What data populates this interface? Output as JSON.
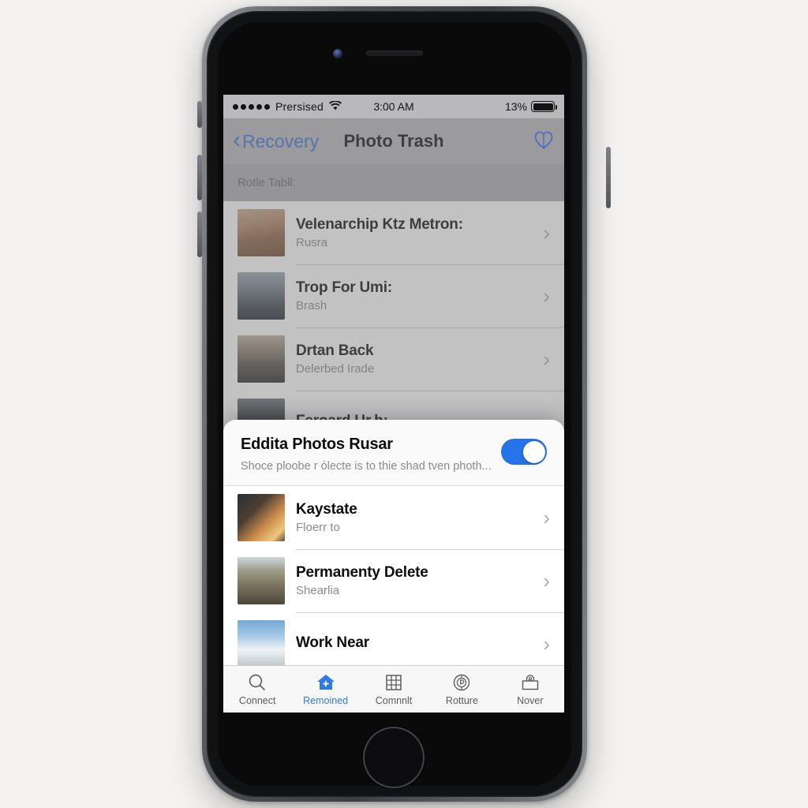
{
  "statusbar": {
    "carrier": "Prersised",
    "signal_dots": 5,
    "wifi_icon": "wifi-icon",
    "time": "3:00 AM",
    "battery_percent": "13%",
    "battery_level": 100
  },
  "navbar": {
    "back_label": "Recovery",
    "back_icon": "chevron-left-icon",
    "title": "Photo Trash",
    "action_icon": "heart-icon",
    "action_color": "#4a6fc4"
  },
  "section_header": {
    "label": "Rotle Tabll:"
  },
  "list": {
    "items": [
      {
        "title": "Velenarchip Ktz Metron:",
        "subtitle": "Rusra",
        "thumb": "stone-tower-photo",
        "chevron": "chevron-right-icon"
      },
      {
        "title": "Trop For Umi:",
        "subtitle": "Brash",
        "thumb": "tower-bridge-photo",
        "chevron": "chevron-right-icon"
      },
      {
        "title": "Drtan Back",
        "subtitle": "Delerbed Irade",
        "thumb": "person-road-photo",
        "chevron": "chevron-right-icon"
      },
      {
        "title": "Feroard Ur.b:",
        "subtitle": "",
        "thumb": "dark-object-photo",
        "chevron": "chevron-right-icon"
      }
    ]
  },
  "sheet": {
    "title": "Eddita Photos Rusar",
    "subtitle": "Shoce ploobe r όlecte is to thie shad tven photh...",
    "toggle_name": "edit-photos-toggle",
    "toggle_on": true,
    "toggle_color": "#2673e8",
    "items": [
      {
        "title": "Kaystate",
        "subtitle": "Floerr to",
        "thumb": "sunset-person-photo",
        "chevron": "chevron-right-icon"
      },
      {
        "title": "Permanenty Delete",
        "subtitle": "Shearlia",
        "thumb": "family-hill-photo",
        "chevron": "chevron-right-icon"
      },
      {
        "title": "Work Near",
        "subtitle": "",
        "thumb": "snow-mountain-photo",
        "chevron": "chevron-right-icon"
      }
    ]
  },
  "tabbar": {
    "active_color": "#2f7ae5",
    "tabs": [
      {
        "label": "Connect",
        "icon": "search-icon",
        "active": false
      },
      {
        "label": "Remoined",
        "icon": "home-add-icon",
        "active": true
      },
      {
        "label": "Comnnlt",
        "icon": "grid-icon",
        "active": false
      },
      {
        "label": "Rotture",
        "icon": "badge-icon",
        "active": false
      },
      {
        "label": "Nover",
        "icon": "person-card-icon",
        "active": false
      }
    ]
  }
}
